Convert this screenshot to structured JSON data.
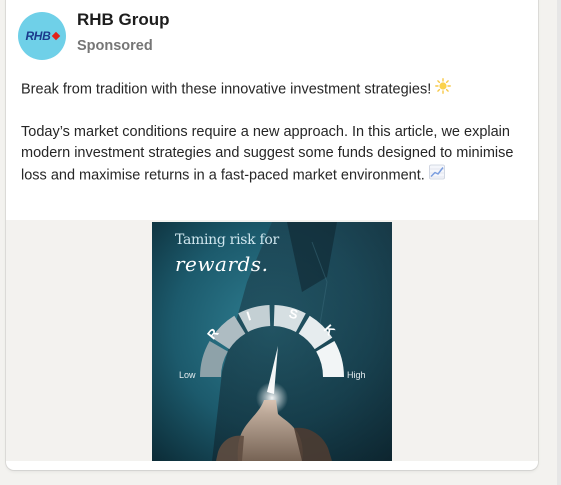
{
  "post": {
    "company_name": "RHB Group",
    "sponsored_label": "Sponsored",
    "logo_text": "RHB",
    "logo_color": "#6fd0e8",
    "paragraph1": "Break from tradition with these innovative investment strategies!",
    "paragraph1_emoji": "sun-emoji",
    "paragraph2": "Today’s market conditions require a new approach. In this article, we explain modern investment strategies and suggest some funds designed to minimise loss and maximise returns in a fast-paced market environment.",
    "paragraph2_emoji": "chart-increasing-emoji"
  },
  "creative": {
    "title_line1": "Taming risk for",
    "title_line2": "rewards.",
    "gauge_letters": [
      "R",
      "I",
      "S",
      "K"
    ],
    "gauge_low": "Low",
    "gauge_high": "High",
    "background_color": "#1c5a6c"
  }
}
